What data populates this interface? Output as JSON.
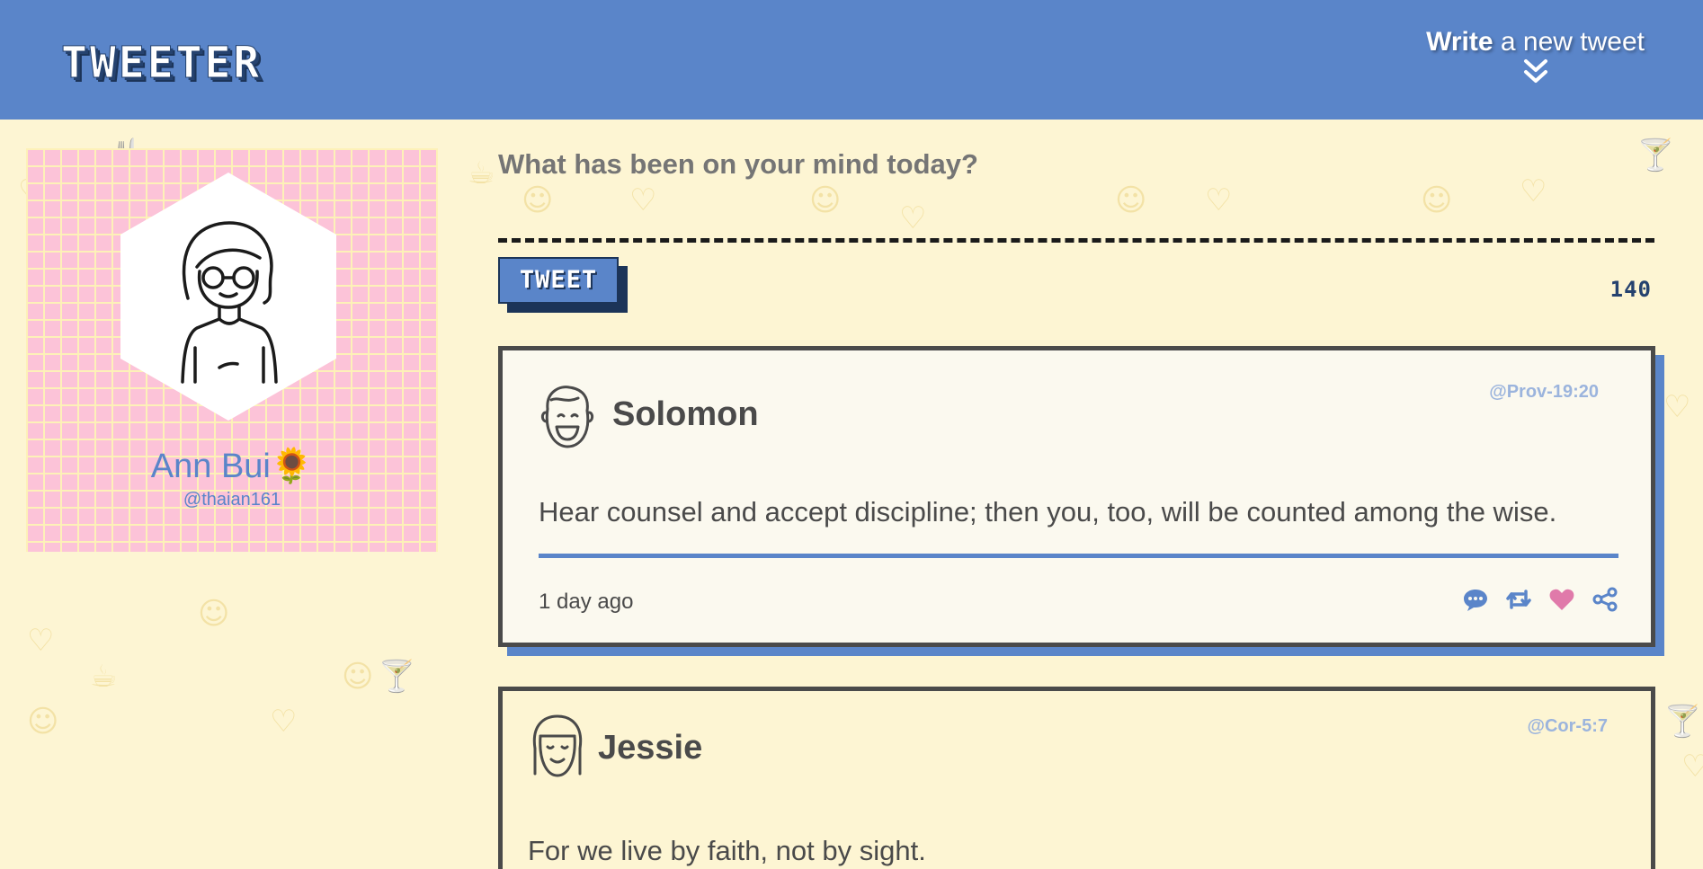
{
  "nav": {
    "logo": "TWEETER",
    "compose_bold": "Write",
    "compose_rest": " a new tweet"
  },
  "profile": {
    "name": "Ann Bui🌻",
    "handle": "@thaian161"
  },
  "composer": {
    "placeholder": "What has been on your mind today?",
    "button_label": "TWEET",
    "counter": "140"
  },
  "tweets": [
    {
      "author": "Solomon",
      "handle": "@Prov-19:20",
      "content": "Hear counsel and accept discipline; then you, too, will be counted among the wise.",
      "time_ago": "1 day ago",
      "actions": [
        "comment-icon",
        "retweet-icon",
        "heart-icon",
        "share-icon"
      ]
    },
    {
      "author": "Jessie",
      "handle": "@Cor-5:7",
      "content": "For we live by faith, not by sight."
    }
  ],
  "colors": {
    "nav": "#5a85c9",
    "background": "#fdf5d3",
    "profile_bg": "#fcc3d8",
    "accent_dark": "#1c3458",
    "heart": "#e07aaa"
  }
}
